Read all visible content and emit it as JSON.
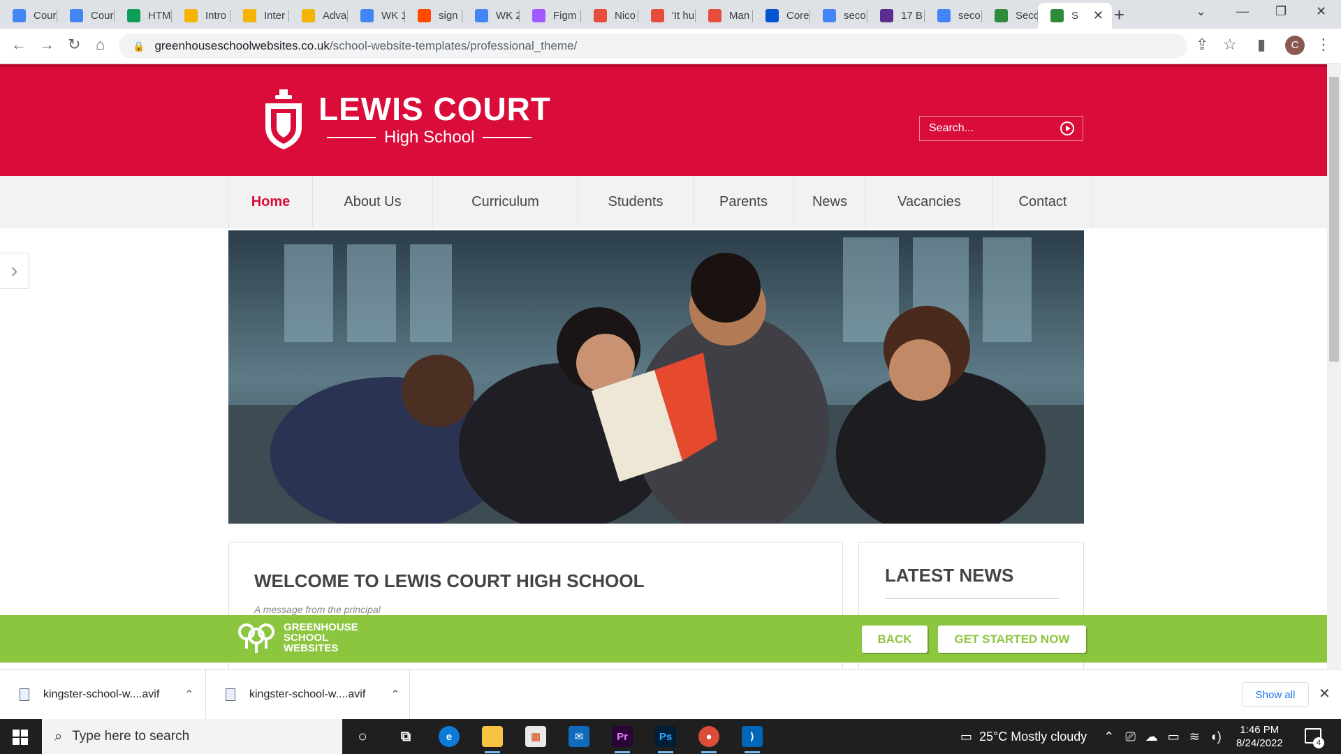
{
  "browser": {
    "tabs": [
      {
        "title": "Cour",
        "icon": "google-docs-icon",
        "color": "#4285f4"
      },
      {
        "title": "Cour",
        "icon": "google-docs-icon",
        "color": "#4285f4"
      },
      {
        "title": "HTM",
        "icon": "google-drive-icon",
        "color": "#0f9d58"
      },
      {
        "title": "Intro",
        "icon": "google-slides-icon",
        "color": "#f4b400"
      },
      {
        "title": "Inter",
        "icon": "google-slides-icon",
        "color": "#f4b400"
      },
      {
        "title": "Adva",
        "icon": "google-slides-icon",
        "color": "#f4b400"
      },
      {
        "title": "WK 1",
        "icon": "google-docs-icon",
        "color": "#4285f4"
      },
      {
        "title": "sign",
        "icon": "zapier-icon",
        "color": "#ff4a00"
      },
      {
        "title": "WK 2",
        "icon": "google-docs-icon",
        "color": "#4285f4"
      },
      {
        "title": "Figm",
        "icon": "figma-icon",
        "color": "#a259ff"
      },
      {
        "title": "Nico",
        "icon": "medium-icon",
        "color": "#e74c3c"
      },
      {
        "title": "'It hu",
        "icon": "medium-icon",
        "color": "#e74c3c"
      },
      {
        "title": "Man",
        "icon": "medium-icon",
        "color": "#e74c3c"
      },
      {
        "title": "Core",
        "icon": "coursera-icon",
        "color": "#0056d2"
      },
      {
        "title": "seco",
        "icon": "google-icon",
        "color": "#4285f4"
      },
      {
        "title": "17 B",
        "icon": "colorlib-icon",
        "color": "#5b2d8e"
      },
      {
        "title": "seco",
        "icon": "google-icon",
        "color": "#4285f4"
      },
      {
        "title": "Seco",
        "icon": "greenhouse-icon",
        "color": "#2e8b3a"
      },
      {
        "title": "S",
        "icon": "greenhouse-icon",
        "color": "#2e8b3a",
        "active": true
      }
    ],
    "address": {
      "host": "greenhouseschoolwebsites.co.uk",
      "path": "/school-website-templates/professional_theme/"
    },
    "profile_initial": "C"
  },
  "site": {
    "logo": {
      "name": "LEWIS COURT",
      "sub": "High School"
    },
    "search_placeholder": "Search...",
    "nav": [
      "Home",
      "About Us",
      "Curriculum",
      "Students",
      "Parents",
      "News",
      "Vacancies",
      "Contact"
    ],
    "nav_active": "Home",
    "welcome_title": "WELCOME TO LEWIS COURT HIGH SCHOOL",
    "welcome_sub": "A message from the principal",
    "news_title": "LATEST NEWS",
    "brand_color": "#d90c3a"
  },
  "promo": {
    "logo_lines": [
      "GREENHOUSE",
      "SCHOOL",
      "WEBSITES"
    ],
    "back_label": "BACK",
    "cta_label": "GET STARTED NOW",
    "color": "#8cc63f"
  },
  "downloads": {
    "items": [
      "kingster-school-w....avif",
      "kingster-school-w....avif"
    ],
    "show_all_label": "Show all"
  },
  "taskbar": {
    "search_placeholder": "Type here to search",
    "weather": "25°C  Mostly cloudy",
    "time": "1:46 PM",
    "date": "8/24/2022",
    "notification_count": "4"
  }
}
